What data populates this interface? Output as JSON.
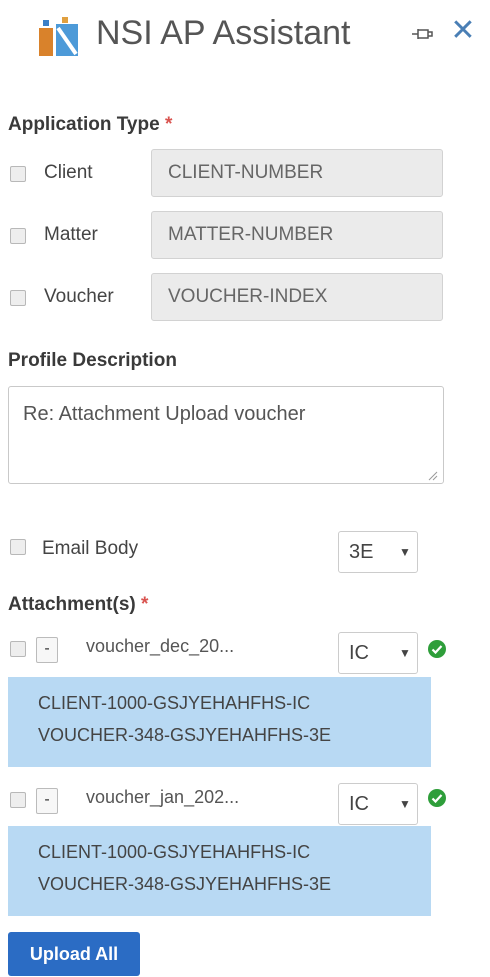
{
  "header": {
    "title": "NSI AP Assistant",
    "pin_icon": "pin-icon",
    "close_icon": "close-icon",
    "close_glyph": "✕"
  },
  "application_type": {
    "label": "Application Type",
    "required_mark": "*",
    "options": [
      {
        "label": "Client",
        "field_value": "CLIENT-NUMBER"
      },
      {
        "label": "Matter",
        "field_value": "MATTER-NUMBER"
      },
      {
        "label": "Voucher",
        "field_value": "VOUCHER-INDEX"
      }
    ]
  },
  "profile": {
    "label": "Profile Description",
    "value": "Re: Attachment Upload voucher"
  },
  "email_body": {
    "label": "Email Body",
    "select_value": "3E"
  },
  "attachments": {
    "label": "Attachment(s)",
    "required_mark": "*",
    "items": [
      {
        "minus_label": "-",
        "name": "voucher_dec_20...",
        "select_value": "IC",
        "lines": [
          "CLIENT-1000-GSJYEHAHFHS-IC",
          "VOUCHER-348-GSJYEHAHFHS-3E"
        ]
      },
      {
        "minus_label": "-",
        "name": "voucher_jan_202...",
        "select_value": "IC",
        "lines": [
          "CLIENT-1000-GSJYEHAHFHS-IC",
          "VOUCHER-348-GSJYEHAHFHS-3E"
        ]
      }
    ]
  },
  "upload_button": {
    "label": "Upload All"
  },
  "colors": {
    "primary": "#2b6cc4",
    "info_bg": "#b8d9f3",
    "required": "#d9534f",
    "success": "#2e9e3a"
  }
}
